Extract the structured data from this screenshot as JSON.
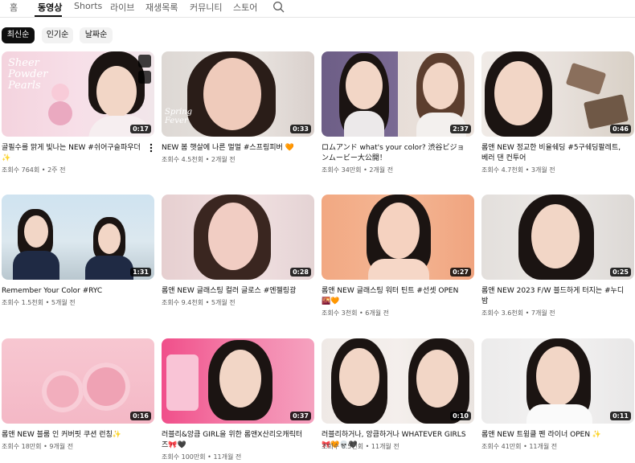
{
  "tabs": [
    "홈",
    "동영상",
    "Shorts",
    "라이브",
    "재생목록",
    "커뮤니티",
    "스토어"
  ],
  "active_tab": "동영상",
  "chips": [
    "최신순",
    "인기순",
    "날짜순"
  ],
  "active_chip": "최신순",
  "thumb_text": {
    "v1": "Sheer Powder Pearls",
    "v2": "Spring Fever"
  },
  "videos": [
    {
      "title": "골필수를 맑게 빛나는 NEW #쉬어구슬파우더 ✨",
      "views": "조회수 764회",
      "age": "2주 전",
      "duration": "0:17"
    },
    {
      "title": "NEW 봄 햇살에 나른 멀멀 #스프링피버 🧡",
      "views": "조회수 4.5천회",
      "age": "2개월 전",
      "duration": "0:33"
    },
    {
      "title": "ロムアンド what's your color? 渋谷ビジョンムービー大公開！",
      "views": "조회수 34만회",
      "age": "2개월 전",
      "duration": "2:37"
    },
    {
      "title": "롬앤 NEW 정교한 비율쉐딩 #5구쉐딩팔레트, 베러 댄 컨투어",
      "views": "조회수 4.7천회",
      "age": "3개월 전",
      "duration": "0:46"
    },
    {
      "title": "Remember Your Color #RYC",
      "views": "조회수 1.5천회",
      "age": "5개월 전",
      "duration": "1:31"
    },
    {
      "title": "롬앤 NEW 글래스팅 컬러 글로스 #엔젤링광",
      "views": "조회수 9.4천회",
      "age": "5개월 전",
      "duration": "0:28"
    },
    {
      "title": "롬앤 NEW 글래스팅 워터 틴트 #선셋 OPEN 🌇🧡",
      "views": "조회수 3천회",
      "age": "6개월 전",
      "duration": "0:27"
    },
    {
      "title": "롬앤 NEW 2023 F/W 블드하게 터지는 #누디 밤",
      "views": "조회수 3.6천회",
      "age": "7개월 전",
      "duration": "0:25"
    },
    {
      "title": "롬앤 NEW 블룸 인 커버핏 쿠션 런칭✨",
      "views": "조회수 18만회",
      "age": "9개월 전",
      "duration": "0:16"
    },
    {
      "title": "러블리&앙큼 GIRL을 위한 롬앤X산리오캐릭터즈🎀🖤",
      "views": "조회수 100만회",
      "age": "11개월 전",
      "duration": "0:37"
    },
    {
      "title": "러블리하거나, 앙큼하거나 WHATEVER GIRLS 🎀🧡💀🖤",
      "views": "조회수 6.5천회",
      "age": "11개월 전",
      "duration": "0:10"
    },
    {
      "title": "롬앤 NEW 트윙클 펜 라이너 OPEN ✨",
      "views": "조회수 41만회",
      "age": "11개월 전",
      "duration": "0:11"
    }
  ],
  "colors": {
    "accent": "#0f0f0f",
    "chip_bg": "#f2f2f2",
    "meta": "#606060"
  }
}
